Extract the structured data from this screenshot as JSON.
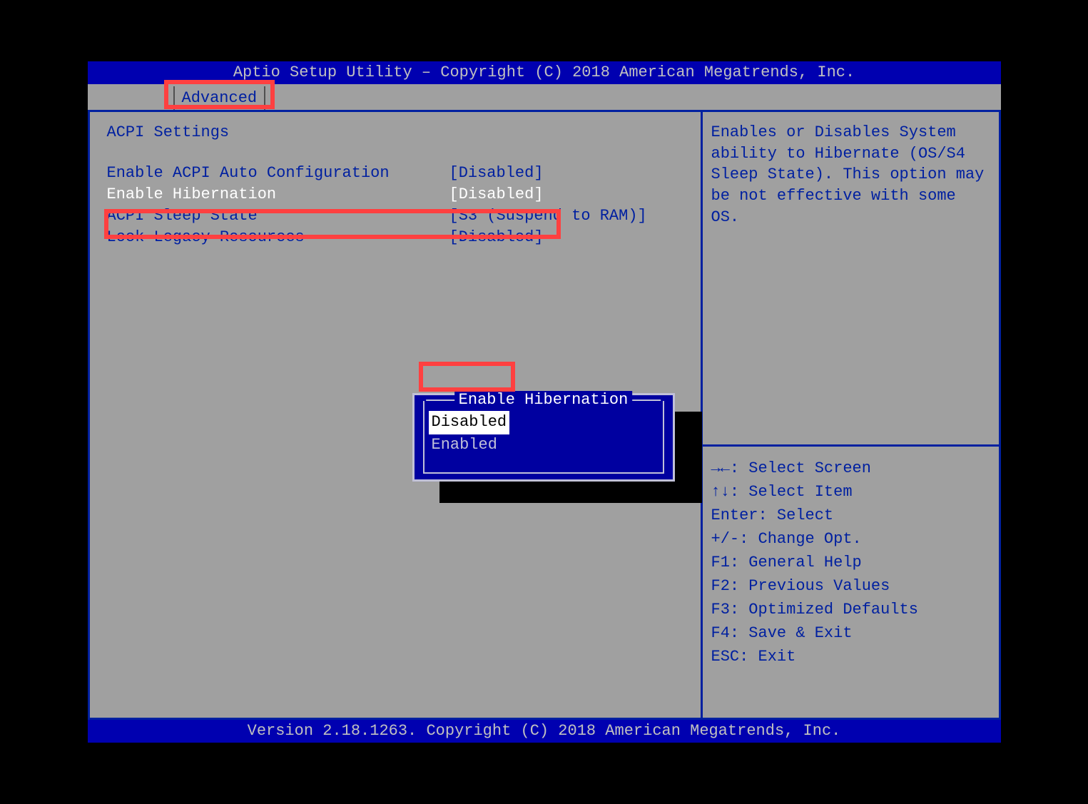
{
  "title_bar": "Aptio Setup Utility – Copyright (C) 2018 American Megatrends, Inc.",
  "tab": "Advanced",
  "section_heading": "ACPI Settings",
  "settings": [
    {
      "label": "Enable ACPI Auto Configuration",
      "value": "[Disabled]",
      "selected": false
    },
    {
      "label": "Enable Hibernation",
      "value": "[Disabled]",
      "selected": true
    },
    {
      "label": "ACPI Sleep State",
      "value": "[S3 (Suspend to RAM)]",
      "selected": false
    },
    {
      "label": "Lock Legacy Resources",
      "value": "[Disabled]",
      "selected": false
    }
  ],
  "popup": {
    "title": "Enable Hibernation",
    "options": [
      {
        "label": "Disabled",
        "selected": true
      },
      {
        "label": "Enabled",
        "selected": false
      }
    ]
  },
  "help_text": "Enables or Disables System ability to Hibernate (OS/S4 Sleep State). This option may be not effective with some OS.",
  "key_help": [
    "→←: Select Screen",
    "↑↓: Select Item",
    "Enter: Select",
    "+/-: Change Opt.",
    "F1: General Help",
    "F2: Previous Values",
    "F3: Optimized Defaults",
    "F4: Save & Exit",
    "ESC: Exit"
  ],
  "footer_bar": "Version 2.18.1263. Copyright (C) 2018 American Megatrends, Inc."
}
